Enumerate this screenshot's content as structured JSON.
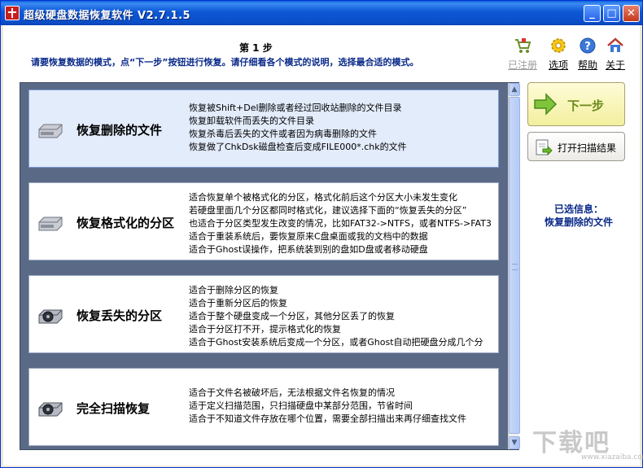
{
  "window": {
    "title": "超级硬盘数据恢复软件 V2.7.1.5",
    "minimize_glyph": "_",
    "maximize_glyph": "□",
    "close_glyph": "✕"
  },
  "header": {
    "step_title": "第 1 步",
    "instruction": "请要恢复数据的模式，点“下一步”按钮进行恢复。请仔细看各个模式的说明，选择最合适的模式。"
  },
  "top_links": [
    {
      "label": "已注册",
      "icon": "cart-icon",
      "enabled": false
    },
    {
      "label": "选项",
      "icon": "gear-icon",
      "enabled": true
    },
    {
      "label": "帮助",
      "icon": "help-icon",
      "enabled": true
    },
    {
      "label": "关于",
      "icon": "home-icon",
      "enabled": true
    }
  ],
  "options": [
    {
      "name": "恢复删除的文件",
      "icon": "disk-icon",
      "selected": true,
      "lines": [
        "恢复被Shift+Del删除或者经过回收站删除的文件目录",
        "恢复卸载软件而丢失的文件目录",
        "恢复杀毒后丢失的文件或者因为病毒删除的文件",
        "恢复做了ChkDsk磁盘检查后变成FILE000*.chk的文件"
      ]
    },
    {
      "name": "恢复格式化的分区",
      "icon": "disk-icon",
      "selected": false,
      "lines": [
        "适合恢复单个被格式化的分区，格式化前后这个分区大小未发生变化",
        "若硬盘里面几个分区都同时格式化，建议选择下面的“恢复丢失的分区”",
        "也适合于分区类型发生改变的情况，比如FAT32->NTFS，或者NTFS->FAT3",
        "适合于重装系统后，要恢复原来C盘桌面或我的文档中的数据",
        "适合于Ghost误操作，把系统装到别的盘如D盘或者移动硬盘"
      ]
    },
    {
      "name": "恢复丢失的分区",
      "icon": "disk-scan-icon",
      "selected": false,
      "lines": [
        "适合于删除分区的恢复",
        "适合于重新分区后的恢复",
        "适合于整个硬盘变成一个分区，其他分区丢了的恢复",
        "适合于分区打不开，提示格式化的恢复",
        "适合于Ghost安装系统后变成一个分区，或者Ghost自动把硬盘分成几个分"
      ]
    },
    {
      "name": "完全扫描恢复",
      "icon": "disk-scan-icon",
      "selected": false,
      "lines": [
        "适合于文件名被破坏后，无法根据文件名恢复的情况",
        "适于定义扫描范围，只扫描硬盘中某部分范围，节省时间",
        "适合于不知道文件存放在哪个位置，需要全部扫描出来再仔细查找文件"
      ]
    }
  ],
  "scrollbar": {
    "up_glyph": "▲",
    "down_glyph": "▼"
  },
  "actions": {
    "next_label": "下一步",
    "open_scan_label": "打开扫描结果"
  },
  "selected_info": {
    "label": "已选信息：",
    "value": "恢复删除的文件"
  },
  "watermark": {
    "main": "下载吧",
    "sub": "www.xiazaiba.com"
  }
}
